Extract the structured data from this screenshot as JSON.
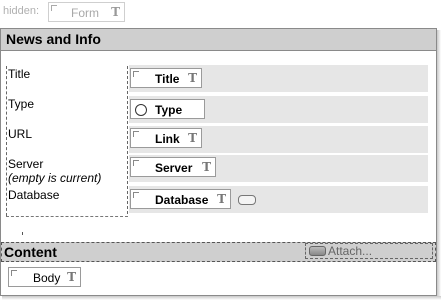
{
  "hidden": {
    "label": "hidden:",
    "field_label": "Form",
    "field_icon": "T"
  },
  "news": {
    "title": "News and Info",
    "rows": [
      {
        "label": "Title",
        "sublabel": "",
        "field": "Title",
        "icon": "T"
      },
      {
        "label": "Type",
        "sublabel": "",
        "field": "Type",
        "icon": "radio"
      },
      {
        "label": "URL",
        "sublabel": "",
        "field": "Link",
        "icon": "T"
      },
      {
        "label": "Server",
        "sublabel": "(empty is current)",
        "field": "Server",
        "icon": "T"
      },
      {
        "label": "Database",
        "sublabel": "",
        "field": "Database",
        "icon": "T"
      }
    ]
  },
  "content": {
    "title": "Content",
    "attach_label": "Attach...",
    "body_field": "Body",
    "body_icon": "T"
  }
}
